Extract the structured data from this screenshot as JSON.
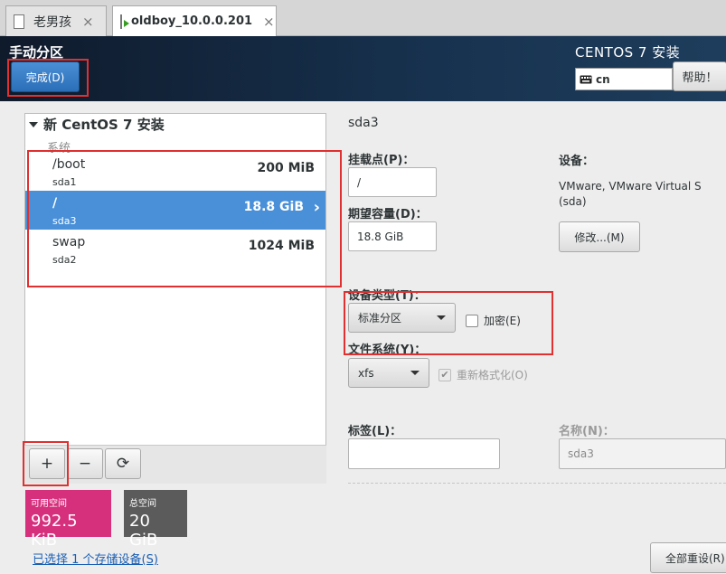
{
  "tabs": [
    {
      "label": "老男孩"
    },
    {
      "label": "oldboy_10.0.0.201"
    }
  ],
  "tab_close_glyph": "×",
  "header": {
    "title": "手动分区",
    "done_label": "完成(D)",
    "product": "CENTOS 7 安装",
    "keyboard_layout": "cn",
    "help_label": "帮助！"
  },
  "left": {
    "install_title": "新 CentOS 7 安装",
    "group_label": "系统",
    "partitions": [
      {
        "mount": "/boot",
        "device": "sda1",
        "size": "200 MiB"
      },
      {
        "mount": "/",
        "device": "sda3",
        "size": "18.8 GiB"
      },
      {
        "mount": "swap",
        "device": "sda2",
        "size": "1024 MiB"
      }
    ],
    "selected_index": 1,
    "toolbar": {
      "add": "+",
      "remove": "−",
      "refresh": "⟳"
    },
    "available_label": "可用空间",
    "available_value": "992.5 KiB",
    "total_label": "总空间",
    "total_value": "20 GiB",
    "storage_link": "已选择 1 个存储设备(S)"
  },
  "right": {
    "selected_partition": "sda3",
    "mount_label": "挂载点(P)：",
    "mount_value": "/",
    "capacity_label": "期望容量(D)：",
    "capacity_value": "18.8 GiB",
    "device_label": "设备：",
    "device_line1": "VMware, VMware Virtual S",
    "device_line2": "(sda)",
    "modify_label": "修改...(M)",
    "device_type_label": "设备类型(T)：",
    "device_type_value": "标准分区",
    "encrypt_label": "加密(E)",
    "encrypt_checked": false,
    "fs_label": "文件系统(Y)：",
    "fs_value": "xfs",
    "reformat_label": "重新格式化(O)",
    "reformat_checked": true,
    "tag_label": "标签(L)：",
    "tag_value": "",
    "name_label": "名称(N)：",
    "name_value": "sda3",
    "reset_label": "全部重设(R)"
  },
  "colors": {
    "selection": "#4a90d9",
    "available_bg": "#d6307d",
    "total_bg": "#5b5b5b",
    "highlight_box": "#e03030",
    "link": "#1a5fb4"
  }
}
